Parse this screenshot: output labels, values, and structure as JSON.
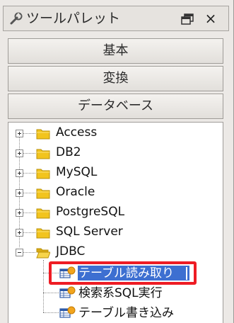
{
  "palette": {
    "title": "ツールパレット",
    "close_glyph": "×",
    "sections": [
      {
        "label": "基本"
      },
      {
        "label": "変換"
      },
      {
        "label": "データベース"
      }
    ],
    "tree": {
      "folders": [
        {
          "label": "Access",
          "expanded": false
        },
        {
          "label": "DB2",
          "expanded": false
        },
        {
          "label": "MySQL",
          "expanded": false
        },
        {
          "label": "Oracle",
          "expanded": false
        },
        {
          "label": "PostgreSQL",
          "expanded": false
        },
        {
          "label": "SQL Server",
          "expanded": false
        },
        {
          "label": "JDBC",
          "expanded": true
        }
      ],
      "jdbc_items": [
        {
          "label": "テーブル読み取り",
          "selected": true
        },
        {
          "label": "検索系SQL実行",
          "selected": false
        },
        {
          "label": "テーブル書き込み",
          "selected": false
        }
      ]
    }
  },
  "colors": {
    "selection": "#3d6fd1",
    "highlight_border": "#ee1c24",
    "folder": "#f2c41e"
  }
}
